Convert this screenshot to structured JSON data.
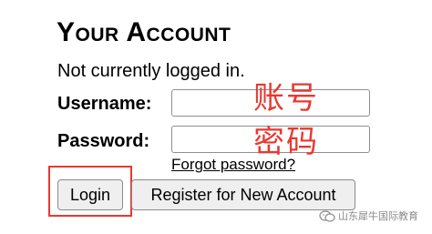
{
  "page": {
    "title": "Your Account",
    "status": "Not currently logged in."
  },
  "form": {
    "username_label": "Username:",
    "username_value": "",
    "password_label": "Password:",
    "password_value": "",
    "forgot_link": "Forgot password?",
    "login_button": "Login",
    "register_button": "Register for New Account"
  },
  "annotations": {
    "username_note": "账号",
    "password_note": "密码",
    "color": "#e8382f"
  },
  "watermark": {
    "text": "山东犀牛国际教育",
    "icon": "wechat-icon"
  }
}
